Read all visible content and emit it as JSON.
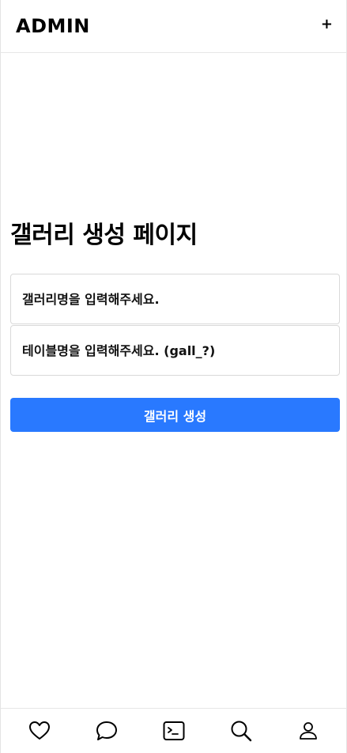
{
  "header": {
    "title": "ADMIN",
    "add_label": "+"
  },
  "main": {
    "title": "갤러리 생성 페이지",
    "gallery_name": {
      "value": "",
      "placeholder": "갤러리명을 입력해주세요."
    },
    "table_name": {
      "value": "",
      "placeholder": "테이블명을 입력해주세요. (gall_?)"
    },
    "submit_label": "갤러리 생성"
  },
  "bottom_nav": {
    "items": [
      {
        "icon": "heart-icon"
      },
      {
        "icon": "chat-bubble-icon"
      },
      {
        "icon": "terminal-icon"
      },
      {
        "icon": "search-icon"
      },
      {
        "icon": "user-icon"
      }
    ]
  },
  "colors": {
    "primary": "#2979ff",
    "text": "#000000",
    "border": "#d9d9d9"
  }
}
